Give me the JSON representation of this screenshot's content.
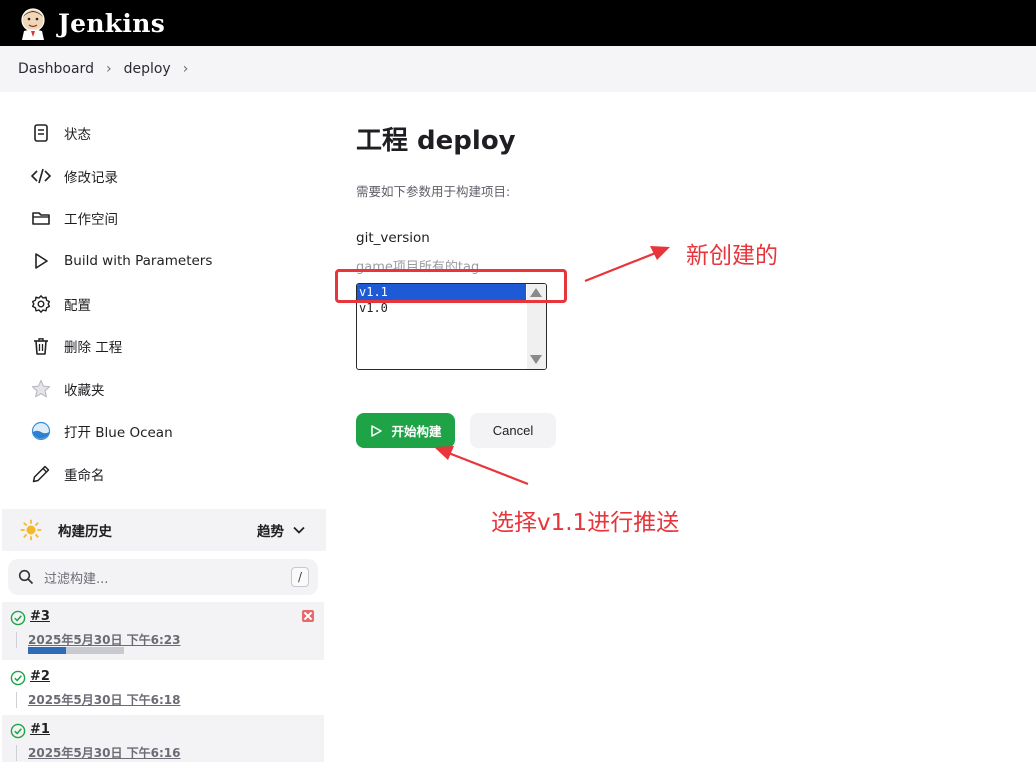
{
  "header": {
    "brand": "Jenkins"
  },
  "breadcrumb": {
    "items": [
      "Dashboard",
      "deploy"
    ]
  },
  "sidebar": {
    "tasks": [
      {
        "label": "状态",
        "icon": "document-icon"
      },
      {
        "label": "修改记录",
        "icon": "code-icon"
      },
      {
        "label": "工作空间",
        "icon": "folder-icon"
      },
      {
        "label": "Build with Parameters",
        "icon": "play-icon"
      },
      {
        "label": "配置",
        "icon": "gear-icon"
      },
      {
        "label": "删除 工程",
        "icon": "trash-icon"
      },
      {
        "label": "收藏夹",
        "icon": "star-icon"
      },
      {
        "label": "打开 Blue Ocean",
        "icon": "blue-ocean-icon"
      },
      {
        "label": "重命名",
        "icon": "pencil-icon"
      }
    ],
    "history": {
      "title": "构建历史",
      "trend": "趋势",
      "filter_placeholder": "过滤构建...",
      "shortcut": "/",
      "builds": [
        {
          "number": "#3",
          "date": "2025年5月30日 下午6:23",
          "progress": 0.4
        },
        {
          "number": "#2",
          "date": "2025年5月30日 下午6:18"
        },
        {
          "number": "#1",
          "date": "2025年5月30日 下午6:16"
        }
      ]
    }
  },
  "main": {
    "title": "工程 deploy",
    "description": "需要如下参数用于构建项目:",
    "parameter": {
      "name": "git_version",
      "description": "game项目所有的tag",
      "options": [
        "v1.1",
        "v1.0"
      ],
      "selected": "v1.1"
    },
    "buttons": {
      "start": "开始构建",
      "cancel": "Cancel"
    }
  },
  "annotations": {
    "new_label": "新创建的",
    "select_label": "选择v1.1进行推送",
    "color": "#e8353b"
  },
  "colors": {
    "accent": "#1ea446",
    "header": "#000000",
    "selection": "#1e5ad6"
  }
}
